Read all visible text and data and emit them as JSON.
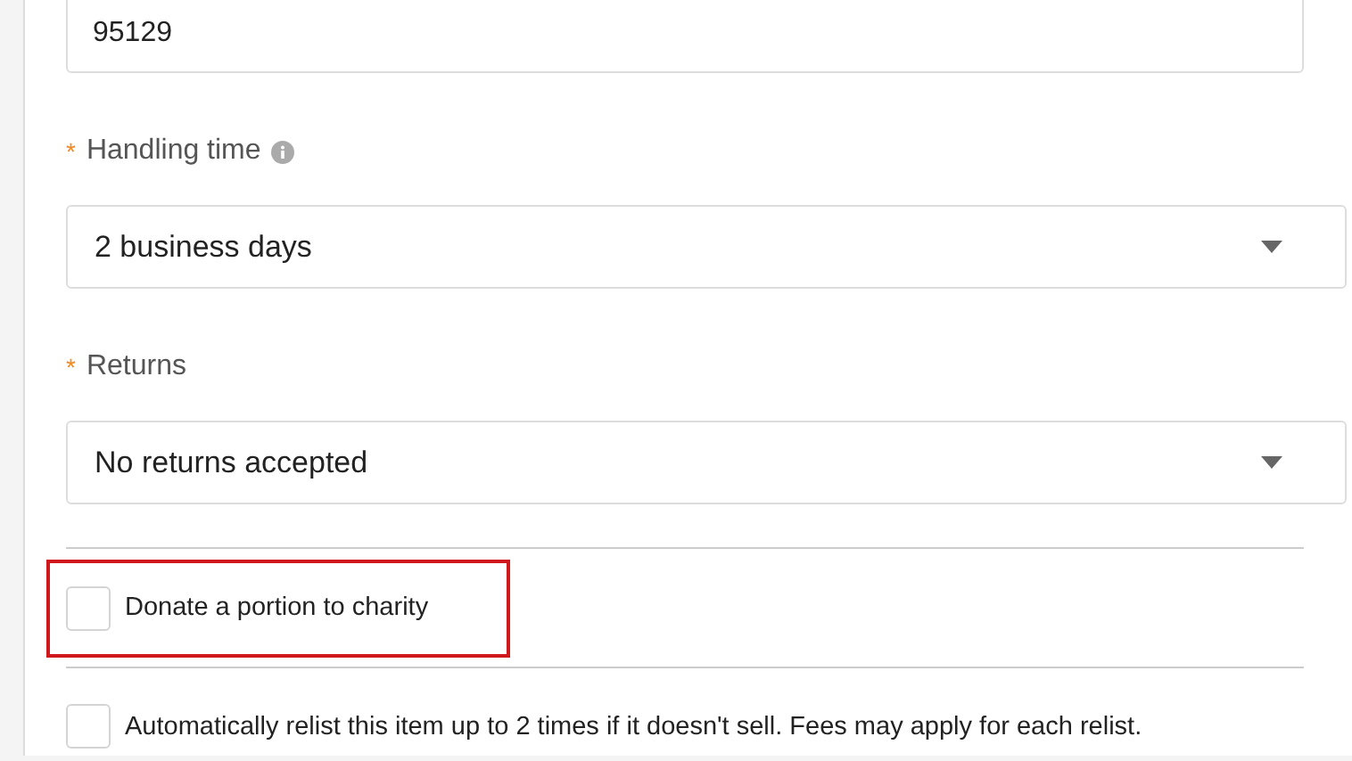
{
  "zip_field": {
    "value": "95129"
  },
  "fields": [
    {
      "label": "Handling time",
      "required_mark": "*",
      "info": true,
      "value": "2 business days"
    },
    {
      "label": "Returns",
      "required_mark": "*",
      "info": false,
      "value": "No returns accepted"
    }
  ],
  "options": [
    {
      "label": "Donate a portion to charity",
      "checked": false,
      "highlighted": true
    },
    {
      "label": "Automatically relist this item up to 2 times if it doesn't sell. Fees may apply for each relist.",
      "checked": false,
      "highlighted": false
    }
  ]
}
